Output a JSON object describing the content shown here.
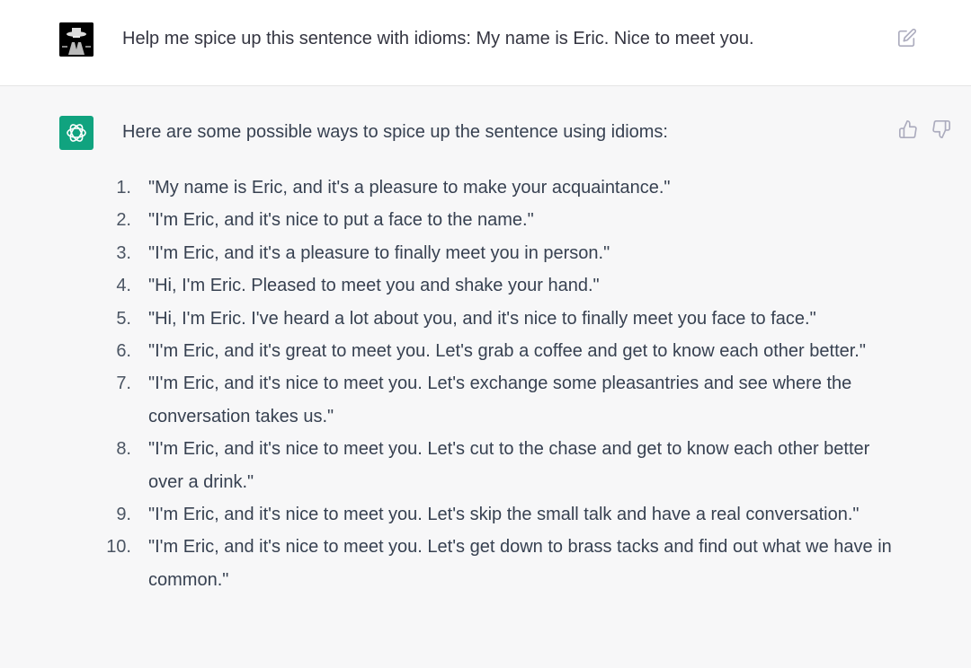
{
  "user_message": {
    "text": "Help me spice up this sentence with idioms: My name is Eric. Nice to meet you."
  },
  "assistant_message": {
    "intro": "Here are some possible ways to spice up the sentence using idioms:",
    "items": [
      {
        "num": "1.",
        "text": "\"My name is Eric, and it's a pleasure to make your acquaintance.\""
      },
      {
        "num": "2.",
        "text": "\"I'm Eric, and it's nice to put a face to the name.\""
      },
      {
        "num": "3.",
        "text": "\"I'm Eric, and it's a pleasure to finally meet you in person.\""
      },
      {
        "num": "4.",
        "text": "\"Hi, I'm Eric. Pleased to meet you and shake your hand.\""
      },
      {
        "num": "5.",
        "text": "\"Hi, I'm Eric. I've heard a lot about you, and it's nice to finally meet you face to face.\""
      },
      {
        "num": "6.",
        "text": "\"I'm Eric, and it's great to meet you. Let's grab a coffee and get to know each other better.\""
      },
      {
        "num": "7.",
        "text": "\"I'm Eric, and it's nice to meet you. Let's exchange some pleasantries and see where the conversation takes us.\""
      },
      {
        "num": "8.",
        "text": "\"I'm Eric, and it's nice to meet you. Let's cut to the chase and get to know each other better over a drink.\""
      },
      {
        "num": "9.",
        "text": "\"I'm Eric, and it's nice to meet you. Let's skip the small talk and have a real conversation.\""
      },
      {
        "num": "10.",
        "text": "\"I'm Eric, and it's nice to meet you. Let's get down to brass tacks and find out what we have in common.\""
      }
    ]
  },
  "icons": {
    "user_avatar": "user-avatar",
    "assistant_avatar": "openai-logo-icon",
    "edit": "edit-icon",
    "thumbs_up": "thumbs-up-icon",
    "thumbs_down": "thumbs-down-icon"
  },
  "colors": {
    "brand": "#10a37f",
    "user_bg": "#ffffff",
    "assistant_bg": "#f7f7f8",
    "text": "#374151"
  }
}
